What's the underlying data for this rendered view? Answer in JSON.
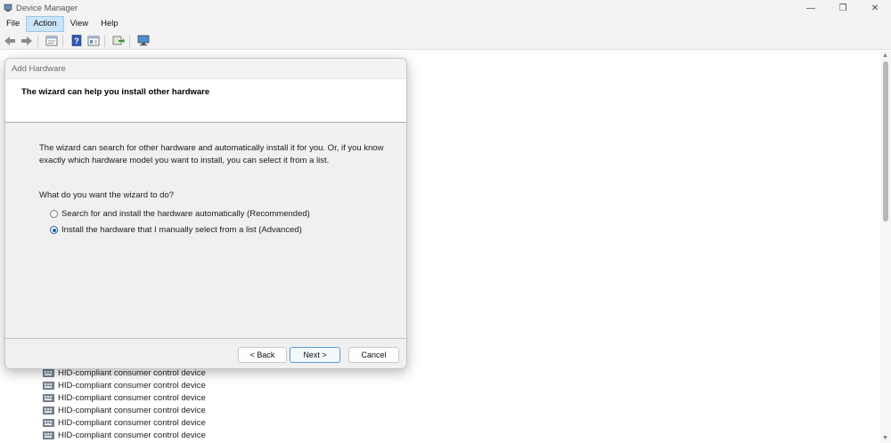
{
  "window": {
    "title": "Device Manager",
    "controls": {
      "minimize": "—",
      "maximize": "❐",
      "close": "✕"
    }
  },
  "menubar": {
    "items": [
      "File",
      "Action",
      "View",
      "Help"
    ],
    "active": "Action"
  },
  "toolbar": {
    "buttons": [
      "back-icon",
      "forward-icon",
      "properties-icon",
      "help-icon",
      "details-icon",
      "update-driver-icon",
      "monitor-icon"
    ]
  },
  "device_list": {
    "items": [
      "HID-compliant consumer control device",
      "HID-compliant consumer control device",
      "HID-compliant consumer control device",
      "HID-compliant consumer control device",
      "HID-compliant consumer control device",
      "HID-compliant consumer control device"
    ]
  },
  "dialog": {
    "title": "Add Hardware",
    "header": "The wizard can help you install other hardware",
    "body_line1": "The wizard can search for other hardware and automatically install it for you. Or, if you know",
    "body_line2": "exactly which hardware model you want to install, you can select it from a list.",
    "question": "What do you want the wizard to do?",
    "options": [
      {
        "label": "Search for and install the hardware automatically (Recommended)",
        "checked": false
      },
      {
        "label": "Install the hardware that I manually select from a list (Advanced)",
        "checked": true
      }
    ],
    "buttons": {
      "back": "< Back",
      "next": "Next >",
      "cancel": "Cancel"
    }
  },
  "colors": {
    "accent": "#1a5fa8",
    "menu_highlight": "#cce4f7"
  }
}
